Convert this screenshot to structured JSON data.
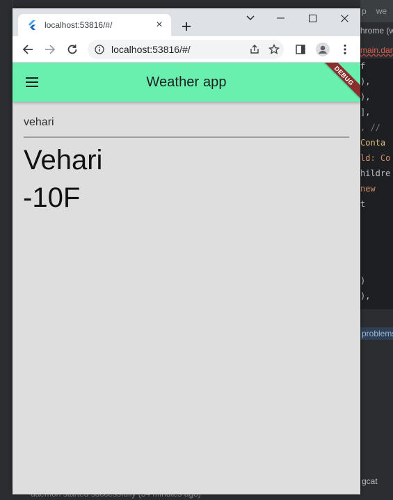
{
  "ide": {
    "top_tabs": [
      "p",
      "we"
    ],
    "tab_label": "hrome (w",
    "file_tab": "main.dart",
    "code_lines": [
      {
        "text": "      f",
        "cls": ""
      },
      {
        "text": "    ),",
        "cls": ""
      },
      {
        "text": "  ),",
        "cls": ""
      },
      {
        "text": " ],",
        "cls": ""
      },
      {
        "text": ", // ",
        "cls": "cm"
      },
      {
        "text": " Conta",
        "cls": "cls"
      },
      {
        "text": "ld: Co",
        "cls": "kw"
      },
      {
        "text": "hildre",
        "cls": ""
      },
      {
        "text": "  new",
        "cls": "kw"
      },
      {
        "text": "    t",
        "cls": ""
      },
      {
        "text": "",
        "cls": ""
      },
      {
        "text": "",
        "cls": ""
      },
      {
        "text": "",
        "cls": ""
      },
      {
        "text": "",
        "cls": ""
      },
      {
        "text": "      )",
        "cls": ""
      },
      {
        "text": "   ),",
        "cls": ""
      }
    ],
    "problems_label": "problems",
    "logcat_label": "gcat",
    "status_text": "daemon started successfully (34 minutes ago)"
  },
  "browser": {
    "tab_title": "localhost:53816/#/",
    "url": "localhost:53816/#/"
  },
  "app": {
    "title": "Weather app",
    "debug_banner": "DEBUG",
    "city_input_value": "vehari",
    "city_name": "Vehari",
    "temperature": "-10F",
    "colors": {
      "appbar": "#69f0ae",
      "background": "#dedede",
      "debug_banner": "#8b2e2e"
    }
  }
}
